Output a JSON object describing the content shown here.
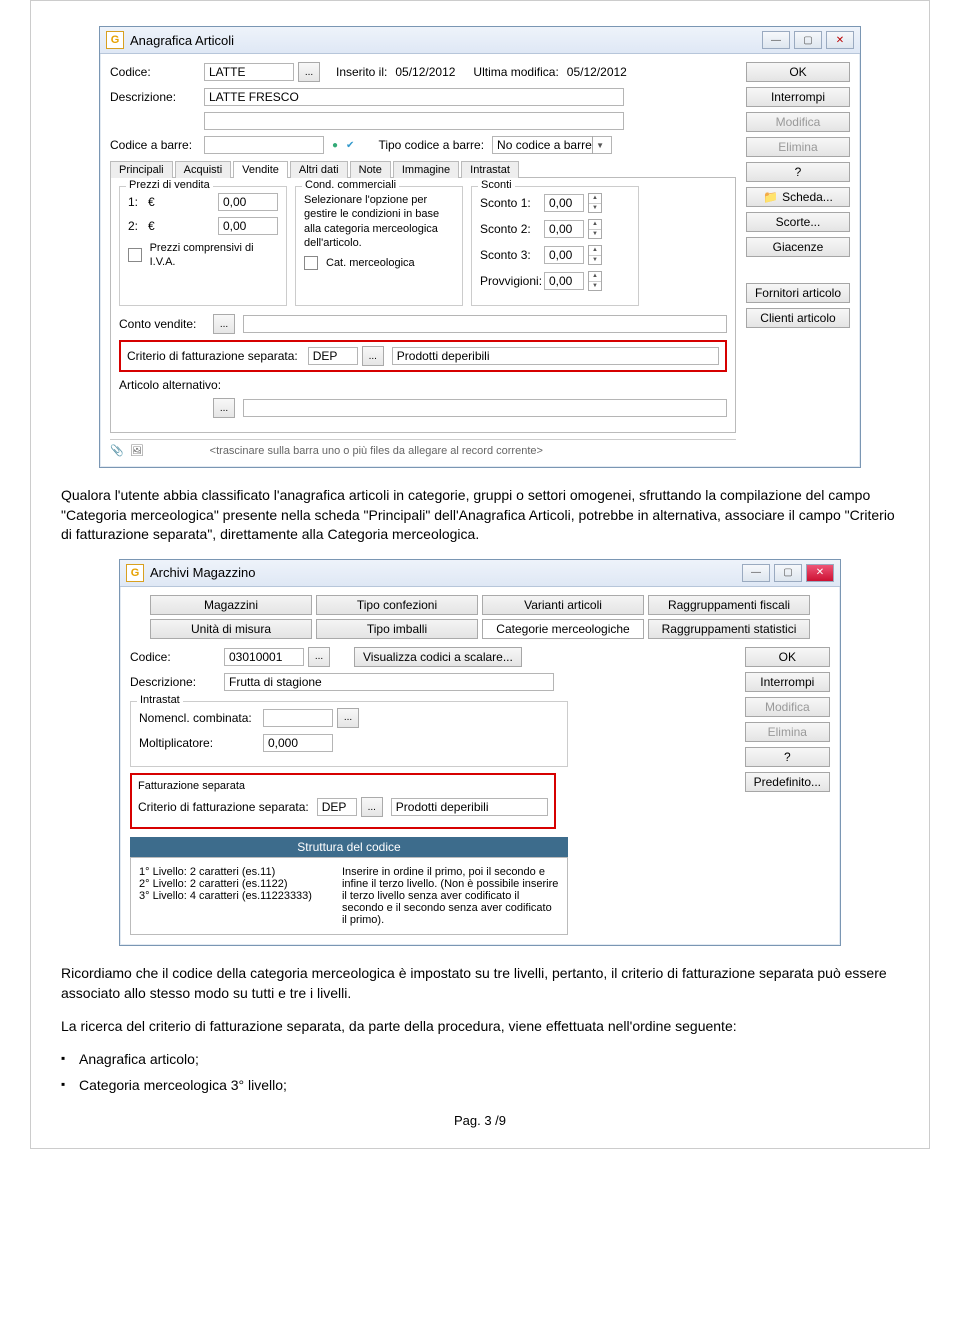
{
  "win1": {
    "title": "Anagrafica Articoli",
    "codice_lbl": "Codice:",
    "codice_val": "LATTE",
    "inserito_lbl": "Inserito il:",
    "inserito_val": "05/12/2012",
    "modifica_lbl": "Ultima modifica:",
    "modifica_val": "05/12/2012",
    "desc_lbl": "Descrizione:",
    "desc_val": "LATTE FRESCO",
    "barre_lbl": "Codice a barre:",
    "tipobarre_lbl": "Tipo codice a barre:",
    "tipobarre_val": "No codice a barre",
    "tabs": [
      "Principali",
      "Acquisti",
      "Vendite",
      "Altri dati",
      "Note",
      "Immagine",
      "Intrastat"
    ],
    "prezzi_title": "Prezzi di vendita",
    "p1": "1:",
    "p2": "2:",
    "pval": "0,00",
    "iva": "Prezzi comprensivi di I.V.A.",
    "cond_title": "Cond. commerciali",
    "cond_txt": "Selezionare l'opzione per gestire le condizioni in base alla categoria merceologica dell'articolo.",
    "cond_chk": "Cat. merceologica",
    "sconti_title": "Sconti",
    "s1": "Sconto 1:",
    "s2": "Sconto 2:",
    "s3": "Sconto 3:",
    "prov": "Provvigioni:",
    "sval": "0,00",
    "conto": "Conto vendite:",
    "crit_lbl": "Criterio di fatturazione separata:",
    "crit_code": "DEP",
    "crit_desc": "Prodotti deperibili",
    "alt": "Articolo alternativo:",
    "drag": "<trascinare sulla barra uno o più files da allegare al record corrente>",
    "side": {
      "ok": "OK",
      "int": "Interrompi",
      "mod": "Modifica",
      "eli": "Elimina",
      "q": "?",
      "scheda": "Scheda...",
      "scorte": "Scorte...",
      "giac": "Giacenze",
      "forn": "Fornitori articolo",
      "cli": "Clienti articolo"
    },
    "folder": "📁"
  },
  "para1": "Qualora l'utente abbia classificato l'anagrafica articoli in categorie, gruppi o settori omogenei, sfruttando la compilazione del campo \"Categoria merceologica\" presente nella scheda \"Principali\" dell'Anagrafica Articoli, potrebbe in alternativa, associare il campo \"Criterio di fatturazione separata\", direttamente alla Categoria merceologica.",
  "win2": {
    "title": "Archivi Magazzino",
    "tabs": [
      "Magazzini",
      "Tipo confezioni",
      "Varianti articoli",
      "Raggruppamenti fiscali",
      "Unità di misura",
      "Tipo imballi",
      "Categorie merceologiche",
      "Raggruppamenti statistici"
    ],
    "codice_lbl": "Codice:",
    "codice_val": "03010001",
    "vis": "Visualizza codici a scalare...",
    "desc_lbl": "Descrizione:",
    "desc_val": "Frutta di stagione",
    "intra": "Intrastat",
    "nom": "Nomencl. combinata:",
    "molt": "Moltiplicatore:",
    "molt_val": "0,000",
    "fatt_title": "Fatturazione separata",
    "crit_lbl": "Criterio di fatturazione separata:",
    "crit_code": "DEP",
    "crit_desc": "Prodotti deperibili",
    "str_title": "Struttura del codice",
    "str_l1": "1° Livello: 2 caratteri (es.11)",
    "str_l2": "2° Livello: 2 caratteri (es.1122)",
    "str_l3": "3° Livello: 4 caratteri (es.11223333)",
    "str_txt": "Inserire in ordine il primo, poi il secondo e infine il terzo livello. (Non è possibile inserire il terzo livello senza aver codificato il secondo e il secondo senza aver codificato il primo).",
    "side": {
      "ok": "OK",
      "int": "Interrompi",
      "mod": "Modifica",
      "eli": "Elimina",
      "q": "?",
      "pre": "Predefinito..."
    }
  },
  "para2": "Ricordiamo che il codice della categoria merceologica è impostato su tre livelli, pertanto, il criterio di fatturazione separata può essere associato allo stesso modo su tutti e tre i livelli.",
  "para3": "La ricerca del criterio di fatturazione separata, da parte della procedura, viene effettuata nell'ordine seguente:",
  "bul1": "Anagrafica articolo;",
  "bul2": "Categoria merceologica 3° livello;",
  "pag": "Pag. 3 /9"
}
